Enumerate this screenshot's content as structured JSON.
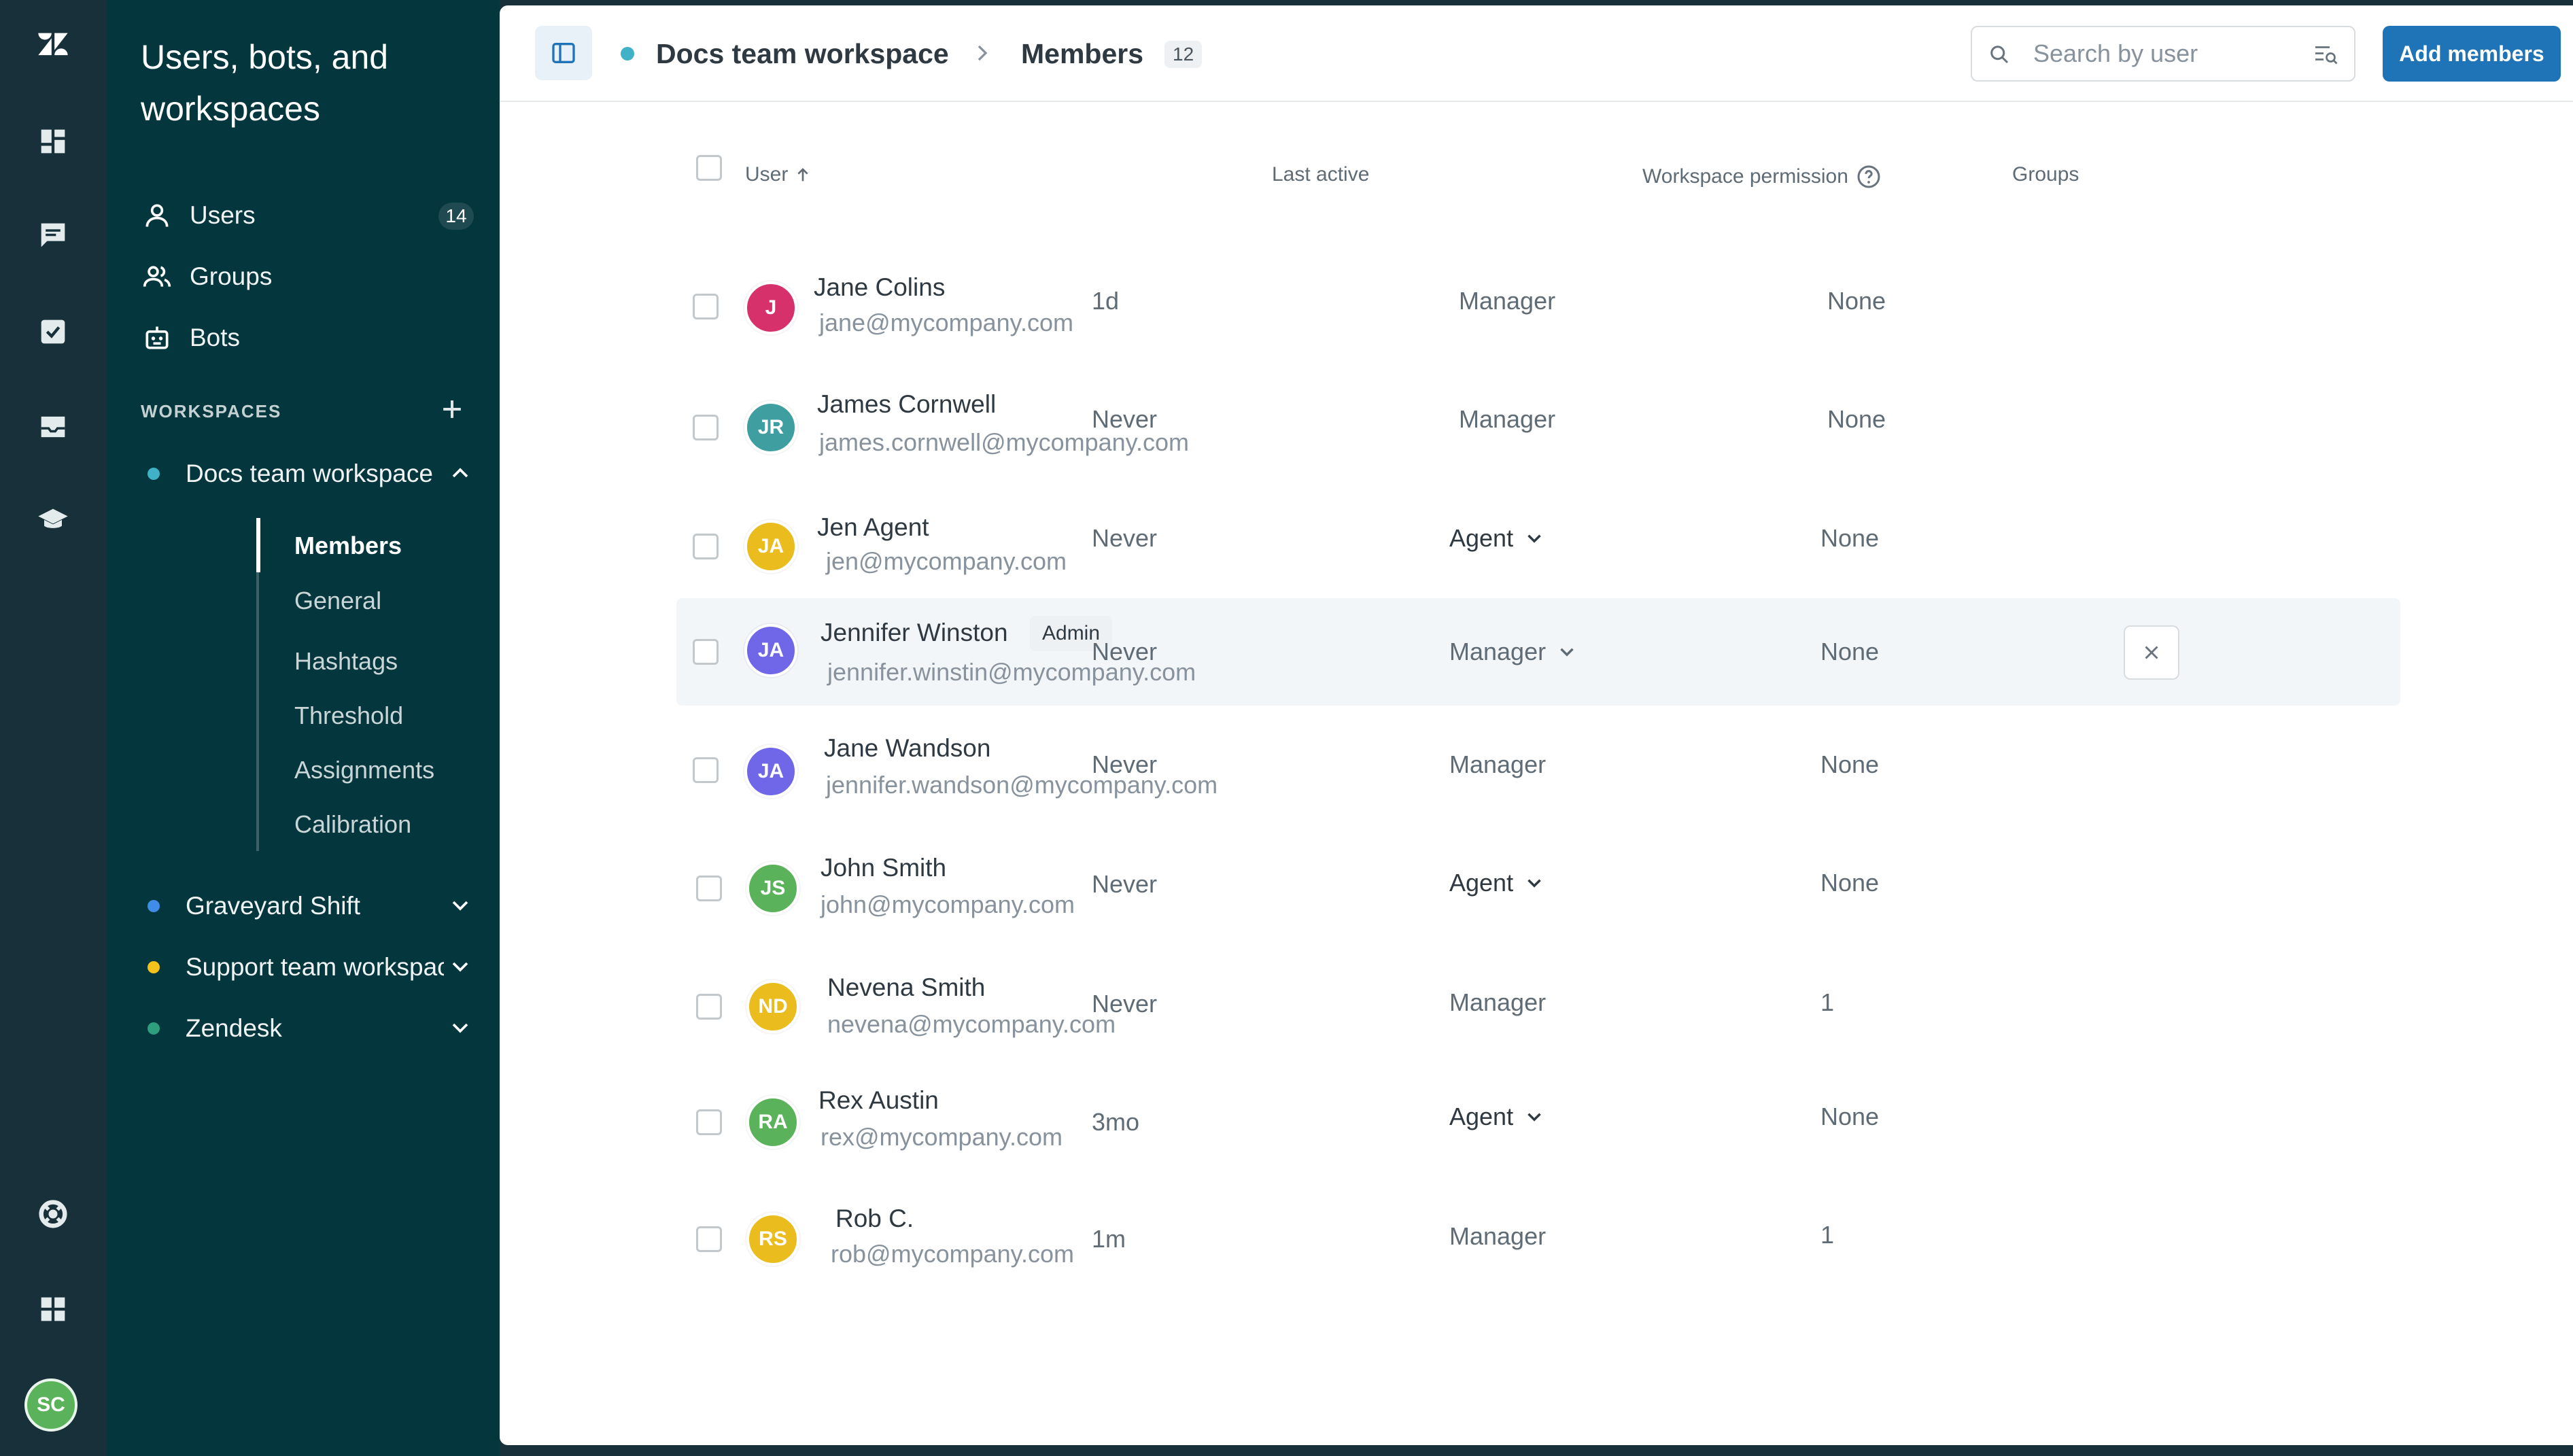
{
  "sidebar": {
    "title": "Users, bots, and workspaces",
    "nav": [
      {
        "label": "Users",
        "count": "14",
        "icon": "user-icon"
      },
      {
        "label": "Groups",
        "icon": "groups-icon"
      },
      {
        "label": "Bots",
        "icon": "bot-icon"
      }
    ],
    "workspaces_heading": "WORKSPACES",
    "workspaces": [
      {
        "label": "Docs team workspace",
        "color": "#3fb2c8",
        "expanded": true
      },
      {
        "label": "Graveyard Shift",
        "color": "#3f8de8"
      },
      {
        "label": "Support team workspace",
        "color": "#f5c21b"
      },
      {
        "label": "Zendesk",
        "color": "#2f9e7c"
      }
    ],
    "subnav": [
      "Members",
      "General",
      "Hashtags",
      "Threshold",
      "Assignments",
      "Calibration"
    ],
    "active_subnav": "Members"
  },
  "rail": {
    "icons": [
      "zendesk-logo-icon",
      "dashboard-icon",
      "conversations-icon",
      "tasks-icon",
      "inbox-icon",
      "training-icon",
      "help-icon",
      "apps-icon"
    ],
    "avatar_initials": "SC"
  },
  "header": {
    "workspace": "Docs team workspace",
    "page": "Members",
    "member_count": "12",
    "search_placeholder": "Search by user",
    "add_button": "Add members"
  },
  "table": {
    "columns": {
      "user": "User",
      "last_active": "Last active",
      "permission": "Workspace permission",
      "groups": "Groups"
    },
    "rows": [
      {
        "initials": "J",
        "color": "#d6316b",
        "name": "Jane Colins",
        "email": "jane@mycompany.com",
        "last_active": "1d",
        "permission": "Manager",
        "dropdown": false,
        "groups": "None"
      },
      {
        "initials": "JR",
        "color": "#3f9ea0",
        "name": "James Cornwell",
        "email": "james.cornwell@mycompany.com",
        "last_active": "Never",
        "permission": "Manager",
        "dropdown": false,
        "groups": "None"
      },
      {
        "initials": "JA",
        "color": "#ebbc1e",
        "name": "Jen Agent",
        "email": "jen@mycompany.com",
        "last_active": "Never",
        "permission": "Agent",
        "dropdown": true,
        "groups": "None"
      },
      {
        "initials": "JA",
        "color": "#6f66e8",
        "name": "Jennifer Winston",
        "badge": "Admin",
        "email": "jennifer.winstin@mycompany.com",
        "last_active": "Never",
        "permission": "Manager",
        "dropdown": true,
        "groups": "None",
        "highlighted": true
      },
      {
        "initials": "JA",
        "color": "#6f66e8",
        "name": "Jane Wandson",
        "email": "jennifer.wandson@mycompany.com",
        "last_active": "Never",
        "permission": "Manager",
        "dropdown": false,
        "groups": "None"
      },
      {
        "initials": "JS",
        "color": "#5ab35a",
        "name": "John Smith",
        "email": "john@mycompany.com",
        "last_active": "Never",
        "permission": "Agent",
        "dropdown": true,
        "groups": "None"
      },
      {
        "initials": "ND",
        "color": "#ebbc1e",
        "name": "Nevena Smith",
        "email": "nevena@mycompany.com",
        "last_active": "Never",
        "permission": "Manager",
        "dropdown": false,
        "groups": "1"
      },
      {
        "initials": "RA",
        "color": "#5ab35a",
        "name": "Rex Austin",
        "email": "rex@mycompany.com",
        "last_active": "3mo",
        "permission": "Agent",
        "dropdown": true,
        "groups": "None"
      },
      {
        "initials": "RS",
        "color": "#ebbc1e",
        "name": "Rob C.",
        "email": "rob@mycompany.com",
        "last_active": "1m",
        "permission": "Manager",
        "dropdown": false,
        "groups": "1"
      }
    ]
  }
}
